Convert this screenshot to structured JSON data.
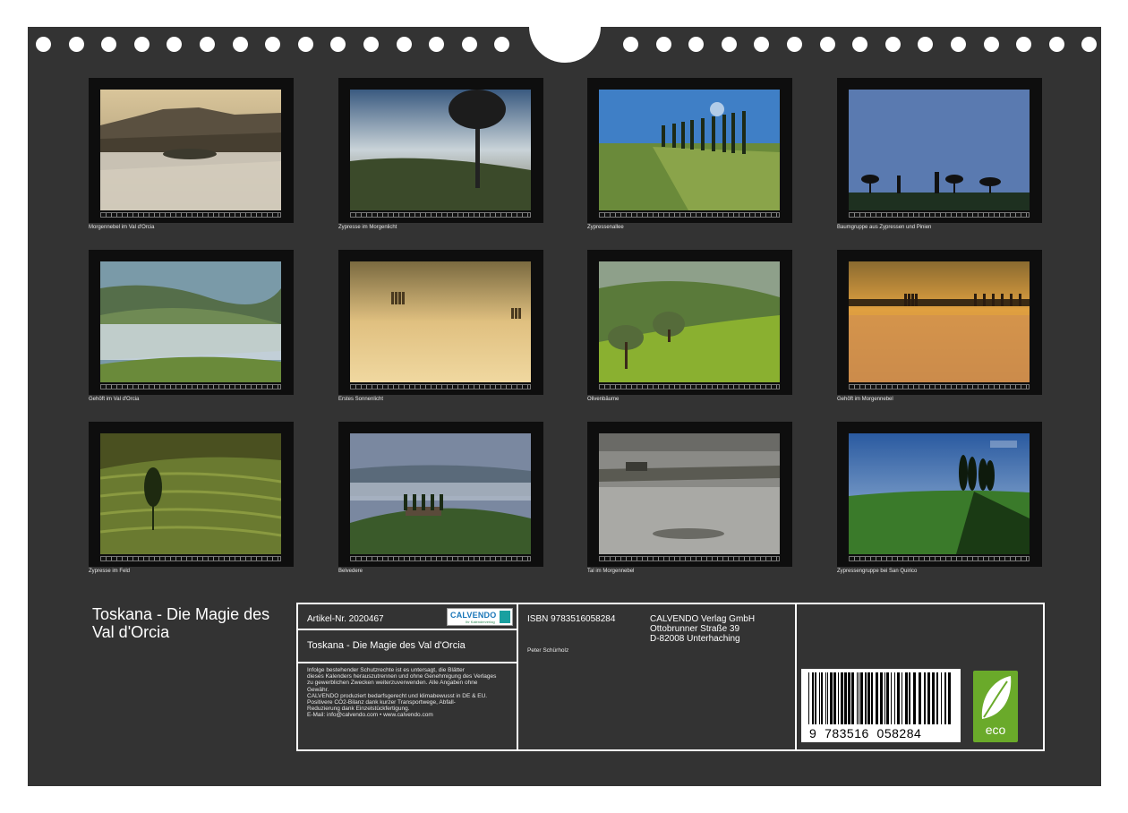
{
  "calendar": {
    "title": "Toskana - Die Magie des Val d'Orcia",
    "months": [
      {
        "caption": "Morgennebel im Val d'Orcia",
        "scene": "fog-valley"
      },
      {
        "caption": "Zypresse im Morgenlicht",
        "scene": "cypress-dawn"
      },
      {
        "caption": "Zypressenallee",
        "scene": "cypress-alley"
      },
      {
        "caption": "Baumgruppe aus Zypressen und Pinien",
        "scene": "tree-silhouettes"
      },
      {
        "caption": "Gehöft im Val d'Orcia",
        "scene": "hills-mist"
      },
      {
        "caption": "Erstes Sonnenlicht",
        "scene": "golden-fog"
      },
      {
        "caption": "Olivenbäume",
        "scene": "olive-trees"
      },
      {
        "caption": "Gehöft im Morgennebel",
        "scene": "farm-fog"
      },
      {
        "caption": "Zypresse im Feld",
        "scene": "lone-cypress"
      },
      {
        "caption": "Belvedere",
        "scene": "belvedere"
      },
      {
        "caption": "Tal im Morgennebel",
        "scene": "grey-fog"
      },
      {
        "caption": "Zypressengruppe bei San Quirico",
        "scene": "cypress-group"
      }
    ]
  },
  "info": {
    "article_label": "Artikel-Nr. 2020467",
    "calvendo_logo": "CALVENDO",
    "calvendo_sub": "Ihr Kalenderverlag",
    "product_title": "Toskana - Die Magie des Val d'Orcia",
    "legal_lines": [
      "Infolge bestehender Schutzrechte ist es untersagt, die Blätter",
      "dieses Kalenders herauszutrennen und ohne Genehmigung des Verlages",
      "zu gewerblichen Zwecken weiterzuverwenden. Alle Angaben ohne",
      "Gewähr.",
      "CALVENDO produziert bedarfsgerecht und klimabewusst in DE & EU.",
      "Positivere CO2-Bilanz dank kurzer Transportwege, Abfall-",
      "Reduzierung dank Einzelstückfertigung.",
      "E-Mail: info@calvendo.com • www.calvendo.com"
    ],
    "isbn": "ISBN 9783516058284",
    "author": "Peter Schürholz",
    "publisher_lines": [
      "CALVENDO Verlag GmbH",
      "Ottobrunner Straße 39",
      "D-82008 Unterhaching"
    ],
    "barcode_digits": "9  783516  058284",
    "eco_label": "eco"
  },
  "colors": {
    "background": "#333333",
    "frame": "#0e0e0e",
    "eco_green": "#6aaa2a"
  }
}
